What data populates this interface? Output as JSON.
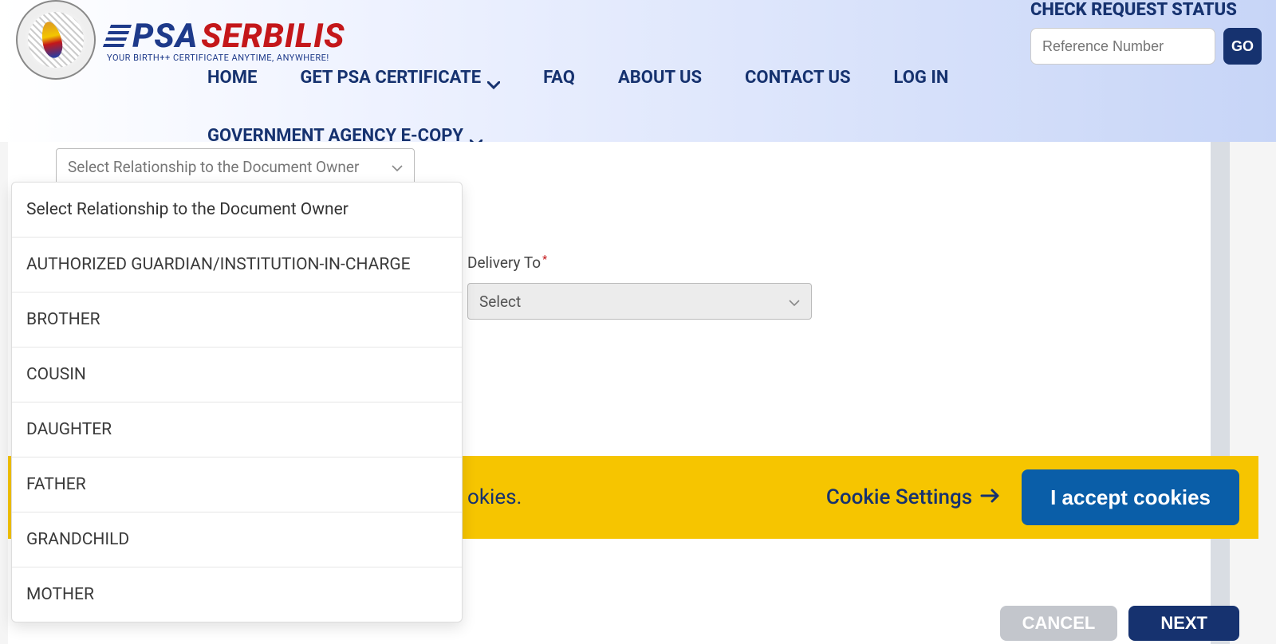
{
  "header": {
    "brand_psa": "PSA",
    "brand_serbilis": "SERBILIS",
    "tagline": "YOUR BIRTH++ CERTIFICATE ANYTIME, ANYWHERE!",
    "status_title": "CHECK REQUEST STATUS",
    "ref_placeholder": "Reference Number",
    "go_label": "GO"
  },
  "nav": {
    "home": "HOME",
    "get_cert": "GET PSA CERTIFICATE",
    "faq": "FAQ",
    "about": "ABOUT US",
    "contact": "CONTACT US",
    "login": "LOG IN",
    "gov_copy": "GOVERNMENT AGENCY E-COPY"
  },
  "form": {
    "relationship_placeholder": "Select Relationship to the Document Owner",
    "delivery_label": "Delivery To",
    "delivery_placeholder": "Select"
  },
  "dropdown": {
    "items": [
      "Select Relationship to the Document Owner",
      "AUTHORIZED GUARDIAN/INSTITUTION-IN-CHARGE",
      "BROTHER",
      "COUSIN",
      "DAUGHTER",
      "FATHER",
      "GRANDCHILD",
      "MOTHER"
    ]
  },
  "cookie": {
    "text": "okies.",
    "settings": "Cookie Settings",
    "accept": "I accept cookies"
  },
  "footer": {
    "cancel": "CANCEL",
    "next": "NEXT"
  }
}
